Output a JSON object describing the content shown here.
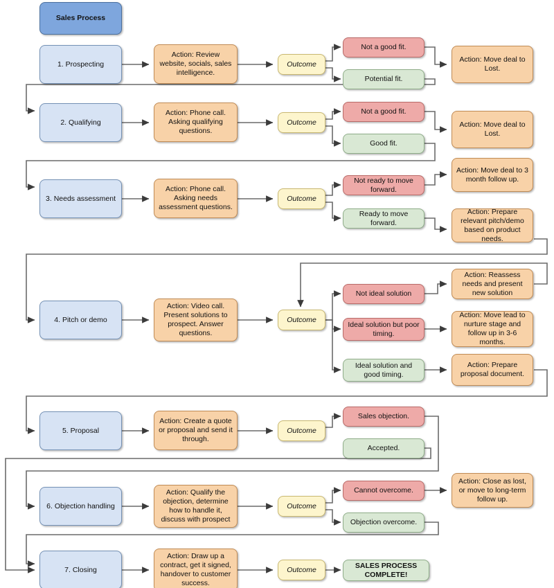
{
  "diagram": {
    "title": "Sales Process",
    "outcome_label": "Outcome",
    "complete_label": "SALES PROCESS COMPLETE!",
    "colors": {
      "title_fill": "#7ea6dd",
      "stage_fill": "#d7e3f4",
      "action_fill": "#f8d2a8",
      "outcome_fill": "#fdf5cd",
      "negative_fill": "#eeaaa8",
      "positive_fill": "#d9e8d4",
      "connector": "#6a6a6a"
    },
    "rows": [
      {
        "stage": "1. Prospecting",
        "action": "Action: Review website, socials, sales intelligence.",
        "outcome": "Outcome",
        "branches": [
          {
            "tone": "negative",
            "label": "Not a good fit.",
            "result": "Action: Move deal to Lost."
          },
          {
            "tone": "positive",
            "label": "Potential fit.",
            "result": ""
          }
        ]
      },
      {
        "stage": "2. Qualifying",
        "action": "Action: Phone call. Asking qualifying questions.",
        "outcome": "Outcome",
        "branches": [
          {
            "tone": "negative",
            "label": "Not a good fit.",
            "result": "Action: Move deal to Lost."
          },
          {
            "tone": "positive",
            "label": "Good fit.",
            "result": ""
          }
        ]
      },
      {
        "stage": "3. Needs assessment",
        "action": "Action: Phone call. Asking needs assessment questions.",
        "outcome": "Outcome",
        "branches": [
          {
            "tone": "negative",
            "label": "Not ready to move forward.",
            "result": "Action: Move deal to 3 month follow up."
          },
          {
            "tone": "positive",
            "label": "Ready to move forward.",
            "result": "Action: Prepare relevant pitch/demo based on product needs."
          }
        ]
      },
      {
        "stage": "4. Pitch or demo",
        "action": "Action: Video call. Present solutions to prospect. Answer questions.",
        "outcome": "Outcome",
        "branches": [
          {
            "tone": "negative",
            "label": "Not ideal solution",
            "result": "Action: Reassess needs and present new solution"
          },
          {
            "tone": "negative",
            "label": "Ideal solution but poor timing.",
            "result": "Action: Move lead to nurture stage and follow up in 3-6 months."
          },
          {
            "tone": "positive",
            "label": "Ideal solution and good timing.",
            "result": "Action: Prepare proposal document."
          }
        ]
      },
      {
        "stage": "5. Proposal",
        "action": "Action: Create a quote or proposal and send it through.",
        "outcome": "Outcome",
        "branches": [
          {
            "tone": "negative",
            "label": "Sales objection.",
            "result": ""
          },
          {
            "tone": "positive",
            "label": "Accepted.",
            "result": ""
          }
        ]
      },
      {
        "stage": "6. Objection handling",
        "action": "Action: Qualify the objection, determine how to handle it, discuss with prospect",
        "outcome": "Outcome",
        "branches": [
          {
            "tone": "negative",
            "label": "Cannot overcome.",
            "result": "Action: Close as lost, or move to long-term follow up."
          },
          {
            "tone": "positive",
            "label": "Objection overcome.",
            "result": ""
          }
        ]
      },
      {
        "stage": "7. Closing",
        "action": "Action: Draw up a contract, get it signed, handover to customer success.",
        "outcome": "Outcome",
        "final": "SALES PROCESS COMPLETE!"
      }
    ]
  }
}
